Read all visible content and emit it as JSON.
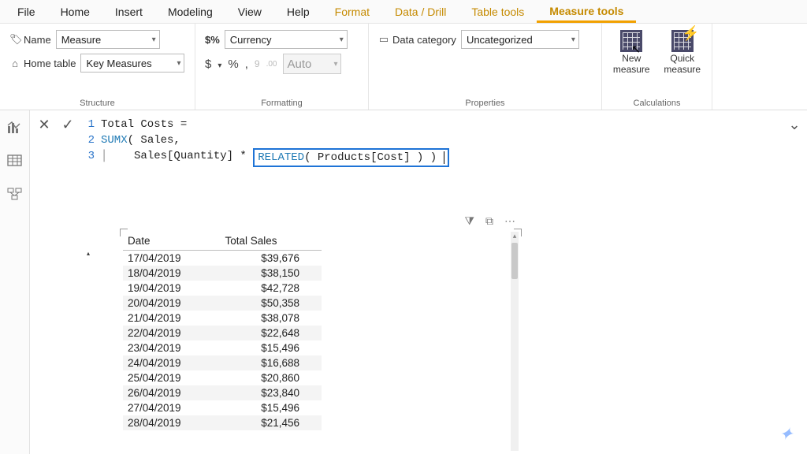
{
  "menu": {
    "items": [
      "File",
      "Home",
      "Insert",
      "Modeling",
      "View",
      "Help"
    ],
    "context_items": [
      "Format",
      "Data / Drill",
      "Table tools",
      "Measure tools"
    ],
    "active": "Measure tools"
  },
  "ribbon": {
    "structure": {
      "label": "Structure",
      "name_label": "Name",
      "name_value": "Measure",
      "home_table_label": "Home table",
      "home_table_value": "Key Measures"
    },
    "formatting": {
      "label": "Formatting",
      "format_prefix": "$%",
      "format_value": "Currency",
      "dollar": "$",
      "percent": "%",
      "comma": ",",
      "sep": "9",
      "dec_btn": ".00→.0",
      "auto": "Auto"
    },
    "properties": {
      "label": "Properties",
      "cat_label": "Data category",
      "cat_value": "Uncategorized"
    },
    "calculations": {
      "label": "Calculations",
      "new_measure": "New measure",
      "quick_measure": "Quick measure"
    }
  },
  "formula": {
    "line1": "Total Costs =",
    "line2_kw": "SUMX",
    "line2_rest": "( Sales,",
    "line3_pre": "    Sales[Quantity] * ",
    "line3_boxed_kw": "RELATED",
    "line3_boxed_rest": "( Products[Cost] ) )"
  },
  "table": {
    "headers": [
      "Date",
      "Total Sales"
    ],
    "rows": [
      [
        "17/04/2019",
        "$39,676"
      ],
      [
        "18/04/2019",
        "$38,150"
      ],
      [
        "19/04/2019",
        "$42,728"
      ],
      [
        "20/04/2019",
        "$50,358"
      ],
      [
        "21/04/2019",
        "$38,078"
      ],
      [
        "22/04/2019",
        "$22,648"
      ],
      [
        "23/04/2019",
        "$15,496"
      ],
      [
        "24/04/2019",
        "$16,688"
      ],
      [
        "25/04/2019",
        "$20,860"
      ],
      [
        "26/04/2019",
        "$23,840"
      ],
      [
        "27/04/2019",
        "$15,496"
      ],
      [
        "28/04/2019",
        "$21,456"
      ]
    ]
  },
  "vis_icons": {
    "filter": "filter-icon",
    "focus": "focus-icon",
    "more": "more-icon"
  }
}
